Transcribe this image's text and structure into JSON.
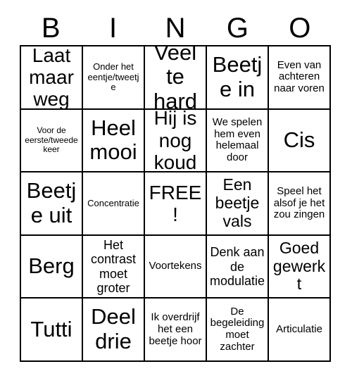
{
  "header": {
    "letters": [
      "B",
      "I",
      "N",
      "G",
      "O"
    ]
  },
  "grid": {
    "rows": [
      [
        {
          "text": "Laat maar weg",
          "size": "s-xl"
        },
        {
          "text": "Onder het eentje/tweetje",
          "size": "s-xs"
        },
        {
          "text": "Veel te hard",
          "size": "s-xxl"
        },
        {
          "text": "Beetje in",
          "size": "s-xxl"
        },
        {
          "text": "Even van achteren naar voren",
          "size": "s-s"
        }
      ],
      [
        {
          "text": "Voor de eerste/tweede keer",
          "size": "s-xxs"
        },
        {
          "text": "Heel mooi",
          "size": "s-xxl"
        },
        {
          "text": "Hij is nog koud",
          "size": "s-xl"
        },
        {
          "text": "We spelen hem even helemaal door",
          "size": "s-s"
        },
        {
          "text": "Cis",
          "size": "s-xxl"
        }
      ],
      [
        {
          "text": "Beetje uit",
          "size": "s-xxl"
        },
        {
          "text": "Concentratie",
          "size": "s-xs"
        },
        {
          "text": "FREE!",
          "size": "s-xl"
        },
        {
          "text": "Een beetje vals",
          "size": "s-l"
        },
        {
          "text": "Speel het alsof je het zou zingen",
          "size": "s-s"
        }
      ],
      [
        {
          "text": "Berg",
          "size": "s-xxl"
        },
        {
          "text": "Het contrast moet groter",
          "size": "s-m"
        },
        {
          "text": "Voortekens",
          "size": "s-s"
        },
        {
          "text": "Denk aan de modulatie",
          "size": "s-m"
        },
        {
          "text": "Goed gewerkt",
          "size": "s-l"
        }
      ],
      [
        {
          "text": "Tutti",
          "size": "s-xxl"
        },
        {
          "text": "Deel drie",
          "size": "s-xxl"
        },
        {
          "text": "Ik overdrijf het een beetje hoor",
          "size": "s-s"
        },
        {
          "text": "De begeleiding moet zachter",
          "size": "s-s"
        },
        {
          "text": "Articulatie",
          "size": "s-s"
        }
      ]
    ]
  }
}
